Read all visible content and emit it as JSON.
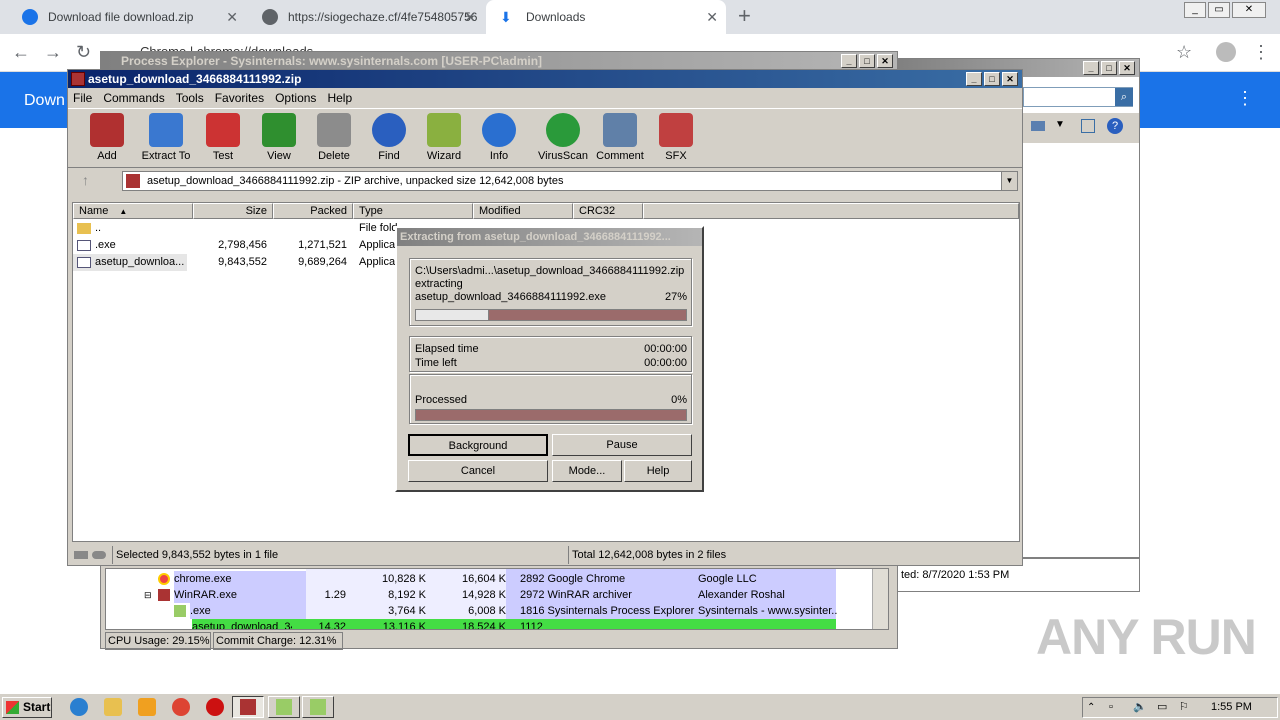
{
  "browser": {
    "tabs": [
      {
        "title": "Download file download.zip",
        "icon_color": "#1a73e8"
      },
      {
        "title": "https://siogechaze.cf/4fe754805756",
        "icon_color": "#5f6368"
      },
      {
        "title": "Downloads",
        "icon_color": "#1a73e8"
      }
    ],
    "address": "Chrome  |  chrome://downloads",
    "page_title": "Down"
  },
  "process_explorer": {
    "title": "Process Explorer - Sysinternals: www.sysinternals.com [USER-PC\\admin]",
    "rows": [
      {
        "name": "chrome.exe",
        "cpu": "",
        "private": "10,828 K",
        "working": "16,604 K",
        "desc": "2892 Google Chrome",
        "company": "Google LLC",
        "color": "#ccccff"
      },
      {
        "name": "WinRAR.exe",
        "cpu": "1.29",
        "private": "8,192 K",
        "working": "14,928 K",
        "desc": "2972 WinRAR archiver",
        "company": "Alexander Roshal",
        "color": "#ccccff"
      },
      {
        "name": ".exe",
        "cpu": "",
        "private": "3,764 K",
        "working": "6,008 K",
        "desc": "1816 Sysinternals Process Explorer",
        "company": "Sysinternals - www.sysinter...",
        "color": "#ccccff"
      },
      {
        "name": "asetup_download_34...",
        "cpu": "14.32",
        "private": "13,116 K",
        "working": "18,524 K",
        "desc": "1112",
        "company": "",
        "color": "#44dd44"
      }
    ],
    "cpu_usage": "CPU Usage: 29.15%",
    "commit_charge": "Commit Charge: 12.31%",
    "right_pane_text": "ted: 8/7/2020 1:53 PM"
  },
  "winrar": {
    "title": "asetup_download_3466884111992.zip",
    "menu": [
      "File",
      "Commands",
      "Tools",
      "Favorites",
      "Options",
      "Help"
    ],
    "toolbar": [
      {
        "label": "Add",
        "color": "#b03030"
      },
      {
        "label": "Extract To",
        "color": "#3a78d0"
      },
      {
        "label": "Test",
        "color": "#cc3333"
      },
      {
        "label": "View",
        "color": "#2f8f2f"
      },
      {
        "label": "Delete",
        "color": "#8c8c8c"
      },
      {
        "label": "Find",
        "color": "#2a5fbf"
      },
      {
        "label": "Wizard",
        "color": "#8ab040"
      },
      {
        "label": "Info",
        "color": "#2a6fd0"
      },
      {
        "label": "VirusScan",
        "color": "#2a9a3a"
      },
      {
        "label": "Comment",
        "color": "#6080a8"
      },
      {
        "label": "SFX",
        "color": "#c04040"
      }
    ],
    "path": "asetup_download_3466884111992.zip - ZIP archive, unpacked size 12,642,008 bytes",
    "columns": [
      "Name",
      "Size",
      "Packed",
      "Type",
      "Modified",
      "CRC32"
    ],
    "files": [
      {
        "name": "..",
        "size": "",
        "packed": "",
        "type": "File fold"
      },
      {
        "name": ".exe",
        "size": "2,798,456",
        "packed": "1,271,521",
        "type": "Applicat"
      },
      {
        "name": "asetup_downloa...",
        "size": "9,843,552",
        "packed": "9,689,264",
        "type": "Applicat"
      }
    ],
    "status_left": "Selected 9,843,552 bytes in 1 file",
    "status_right": "Total 12,642,008 bytes in 2 files"
  },
  "extract_dialog": {
    "title": "Extracting from asetup_download_3466884111992...",
    "archive_path": "C:\\Users\\admi...\\asetup_download_3466884111992.zip",
    "action": "extracting",
    "current_file": "asetup_download_3466884111992.exe",
    "file_percent_text": "27%",
    "file_progress": 0.27,
    "elapsed_label": "Elapsed time",
    "elapsed": "00:00:00",
    "left_label": "Time left",
    "left": "00:00:00",
    "processed_label": "Processed",
    "processed_percent_text": "0%",
    "processed_progress": 0.0,
    "buttons": {
      "background": "Background",
      "pause": "Pause",
      "cancel": "Cancel",
      "mode": "Mode...",
      "help": "Help"
    }
  },
  "taskbar": {
    "start": "Start",
    "clock": "1:55 PM"
  },
  "watermark": "ANY RUN"
}
